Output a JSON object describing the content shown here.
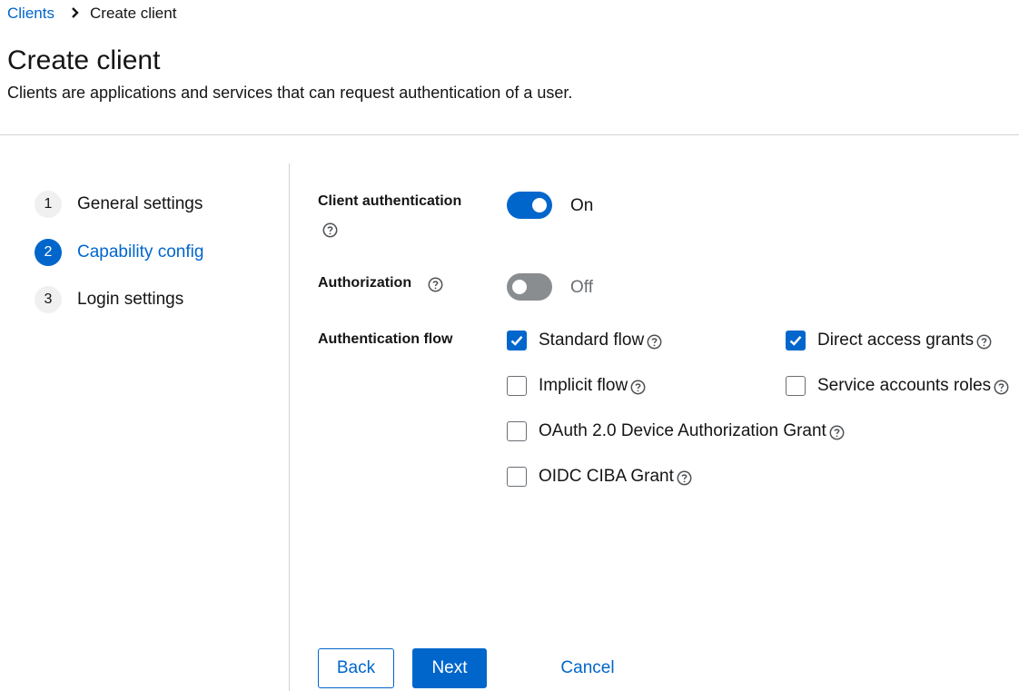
{
  "breadcrumb": {
    "parent": "Clients",
    "current": "Create client"
  },
  "header": {
    "title": "Create client",
    "description": "Clients are applications and services that can request authentication of a user."
  },
  "wizard": {
    "steps": [
      {
        "number": "1",
        "label": "General settings",
        "active": false
      },
      {
        "number": "2",
        "label": "Capability config",
        "active": true
      },
      {
        "number": "3",
        "label": "Login settings",
        "active": false
      }
    ]
  },
  "form": {
    "client_auth": {
      "label": "Client authentication",
      "state": "On"
    },
    "authorization": {
      "label": "Authorization",
      "state": "Off"
    },
    "auth_flow": {
      "label": "Authentication flow",
      "options": [
        {
          "label": "Standard flow",
          "checked": true
        },
        {
          "label": "Direct access grants",
          "checked": true
        },
        {
          "label": "Implicit flow",
          "checked": false
        },
        {
          "label": "Service accounts roles",
          "checked": false
        },
        {
          "label": "OAuth 2.0 Device Authorization Grant",
          "checked": false
        },
        {
          "label": "OIDC CIBA Grant",
          "checked": false
        }
      ]
    }
  },
  "actions": {
    "back": "Back",
    "next": "Next",
    "cancel": "Cancel"
  },
  "colors": {
    "accent": "#0066cc",
    "switch_off": "#8a8d90",
    "divider": "#d2d2d2"
  },
  "icons": {
    "breadcrumb_separator": "chevron-right-icon",
    "help": "help-circle-icon",
    "check": "check-icon"
  }
}
